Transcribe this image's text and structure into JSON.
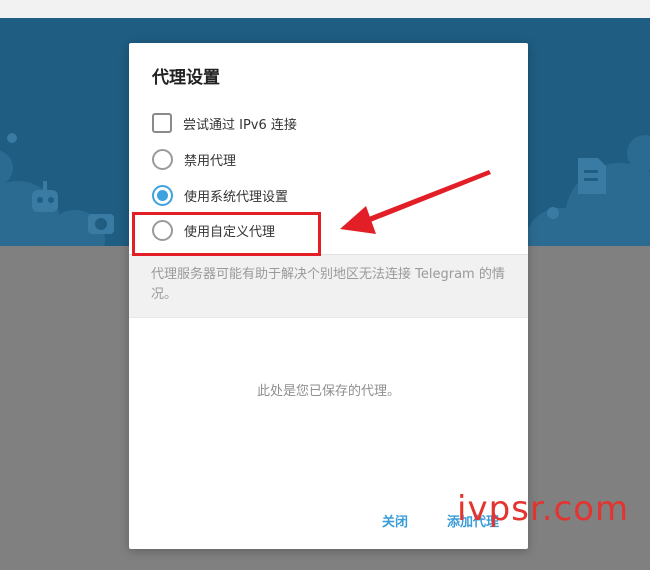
{
  "dialog": {
    "title": "代理设置",
    "options": [
      {
        "type": "checkbox",
        "label": "尝试通过 IPv6 连接",
        "checked": false
      },
      {
        "type": "radio",
        "label": "禁用代理",
        "checked": false
      },
      {
        "type": "radio",
        "label": "使用系统代理设置",
        "checked": true
      },
      {
        "type": "radio",
        "label": "使用自定义代理",
        "checked": false
      }
    ],
    "about": "代理服务器可能有助于解决个别地区无法连接 Telegram 的情况。",
    "empty_list": "此处是您已保存的代理。",
    "buttons": {
      "close": "关闭",
      "add_proxy": "添加代理"
    }
  },
  "annotation": {
    "watermark": "ivpsr.com",
    "highlight_color": "#e21f26"
  },
  "colors": {
    "accent": "#3ea2e0",
    "button_text": "#3a9cd9",
    "background_top": "#1f5d82",
    "overlay": "#808080"
  }
}
